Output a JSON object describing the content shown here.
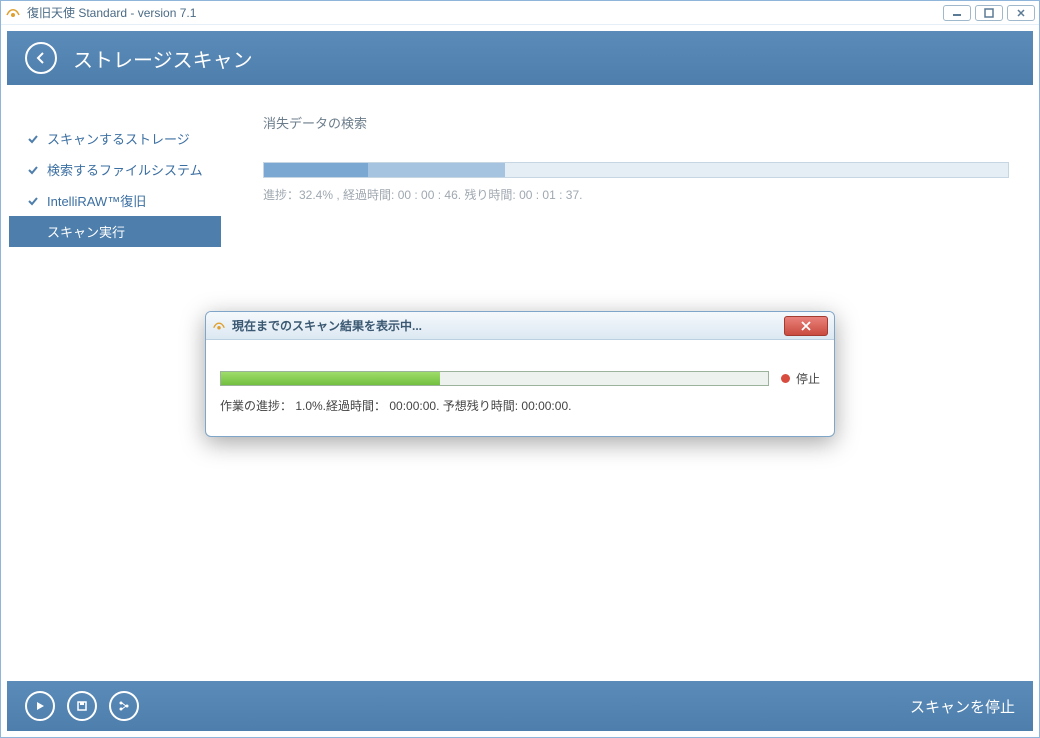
{
  "titlebar": {
    "title": "復旧天使 Standard - version 7.1"
  },
  "header": {
    "page_title": "ストレージスキャン"
  },
  "sidebar": {
    "items": [
      {
        "label": "スキャンするストレージ"
      },
      {
        "label": "検索するファイルシステム"
      },
      {
        "label": "IntelliRAW™復旧"
      },
      {
        "label": "スキャン実行"
      }
    ]
  },
  "main": {
    "section_title": "消失データの検索",
    "progress": {
      "percent": 32.4,
      "text": "進捗：32.4% , 経過時間: 00 : 00 : 46.   残り時間: 00 : 01 : 37."
    }
  },
  "modal": {
    "title": "現在までのスキャン結果を表示中...",
    "stop_label": "停止",
    "status": "作業の進捗： 1.0%.経過時間： 00:00:00. 予想残り時間: 00:00:00.",
    "progress_percent": 40
  },
  "footer": {
    "stop_scan": "スキャンを停止"
  }
}
